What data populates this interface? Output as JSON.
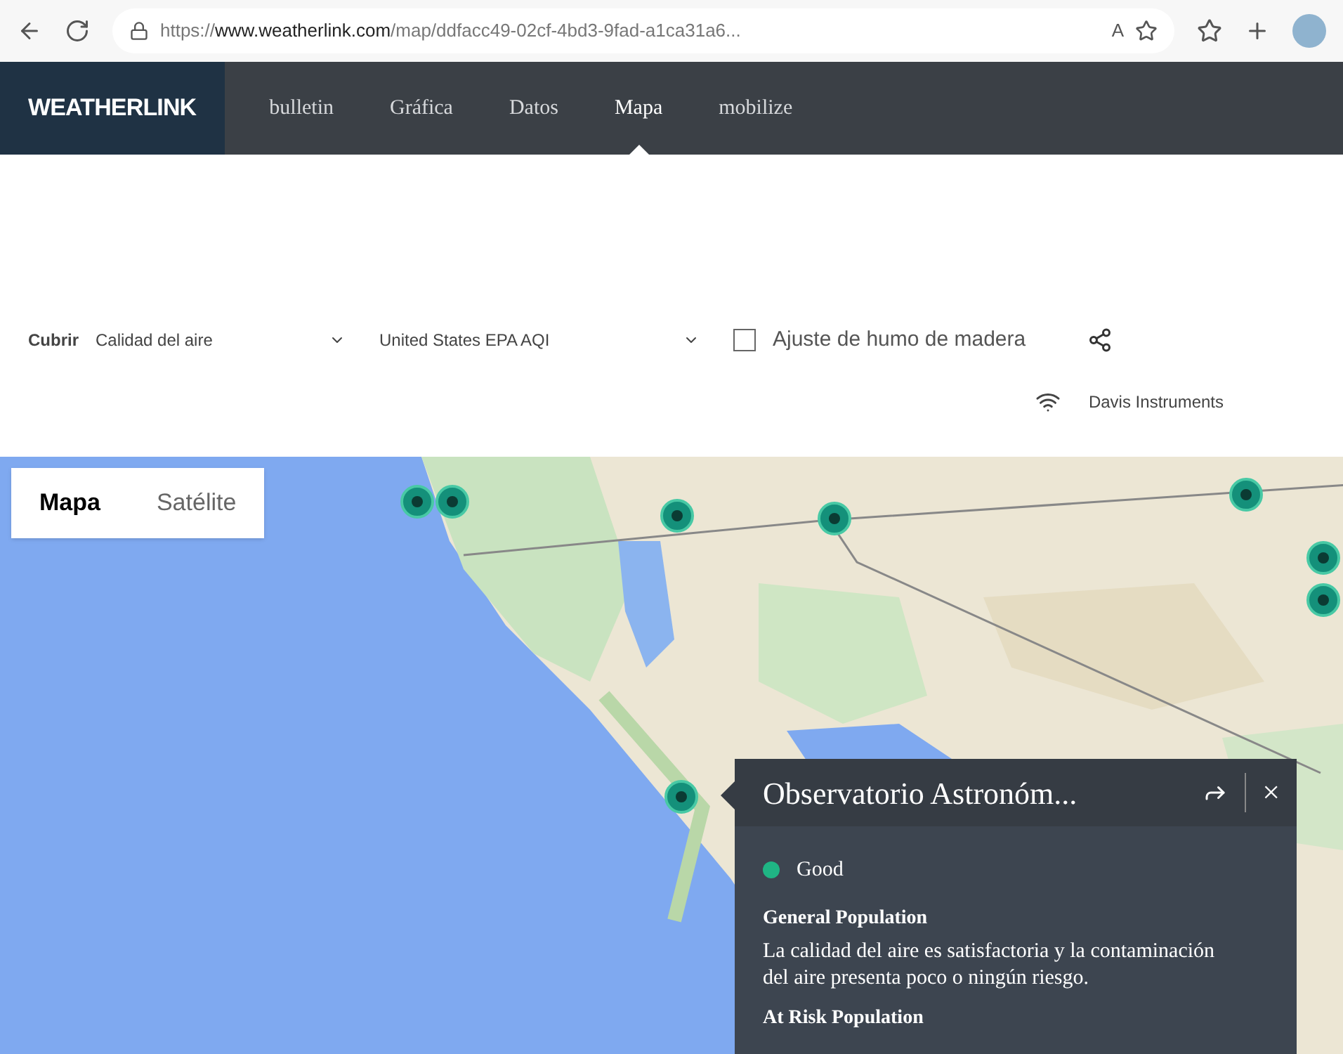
{
  "browser": {
    "url_prefix": "https://",
    "url_domain": "www.weatherlink.com",
    "url_path": "/map/ddfacc49-02cf-4bd3-9fad-a1ca31a6...",
    "read_aloud": "A"
  },
  "nav": {
    "logo": "WEATHERLINK",
    "items": [
      {
        "label": "bulletin",
        "selected": false
      },
      {
        "label": "Gráfica",
        "selected": false
      },
      {
        "label": "Datos",
        "selected": false
      },
      {
        "label": "Mapa",
        "selected": true
      },
      {
        "label": "mobilize",
        "selected": false
      }
    ]
  },
  "controls": {
    "label": "Cubrir",
    "overlay": "Calidad del aire",
    "index": "United States EPA AQI",
    "wood_smoke": {
      "label": "Ajuste de humo de madera",
      "checked": false
    },
    "provider": "Davis Instruments"
  },
  "map": {
    "types": [
      {
        "label": "Mapa",
        "selected": true
      },
      {
        "label": "Satélite",
        "selected": false
      }
    ]
  },
  "popup": {
    "title": "Observatorio Astronóm...",
    "close": "×",
    "status": {
      "label": "Good",
      "color": "#1fb584"
    },
    "sections": [
      {
        "heading": "General Population",
        "text": "La calidad del aire es satisfactoria y la contaminación del aire presenta poco o ningún riesgo."
      },
      {
        "heading": "At Risk Population"
      }
    ]
  }
}
